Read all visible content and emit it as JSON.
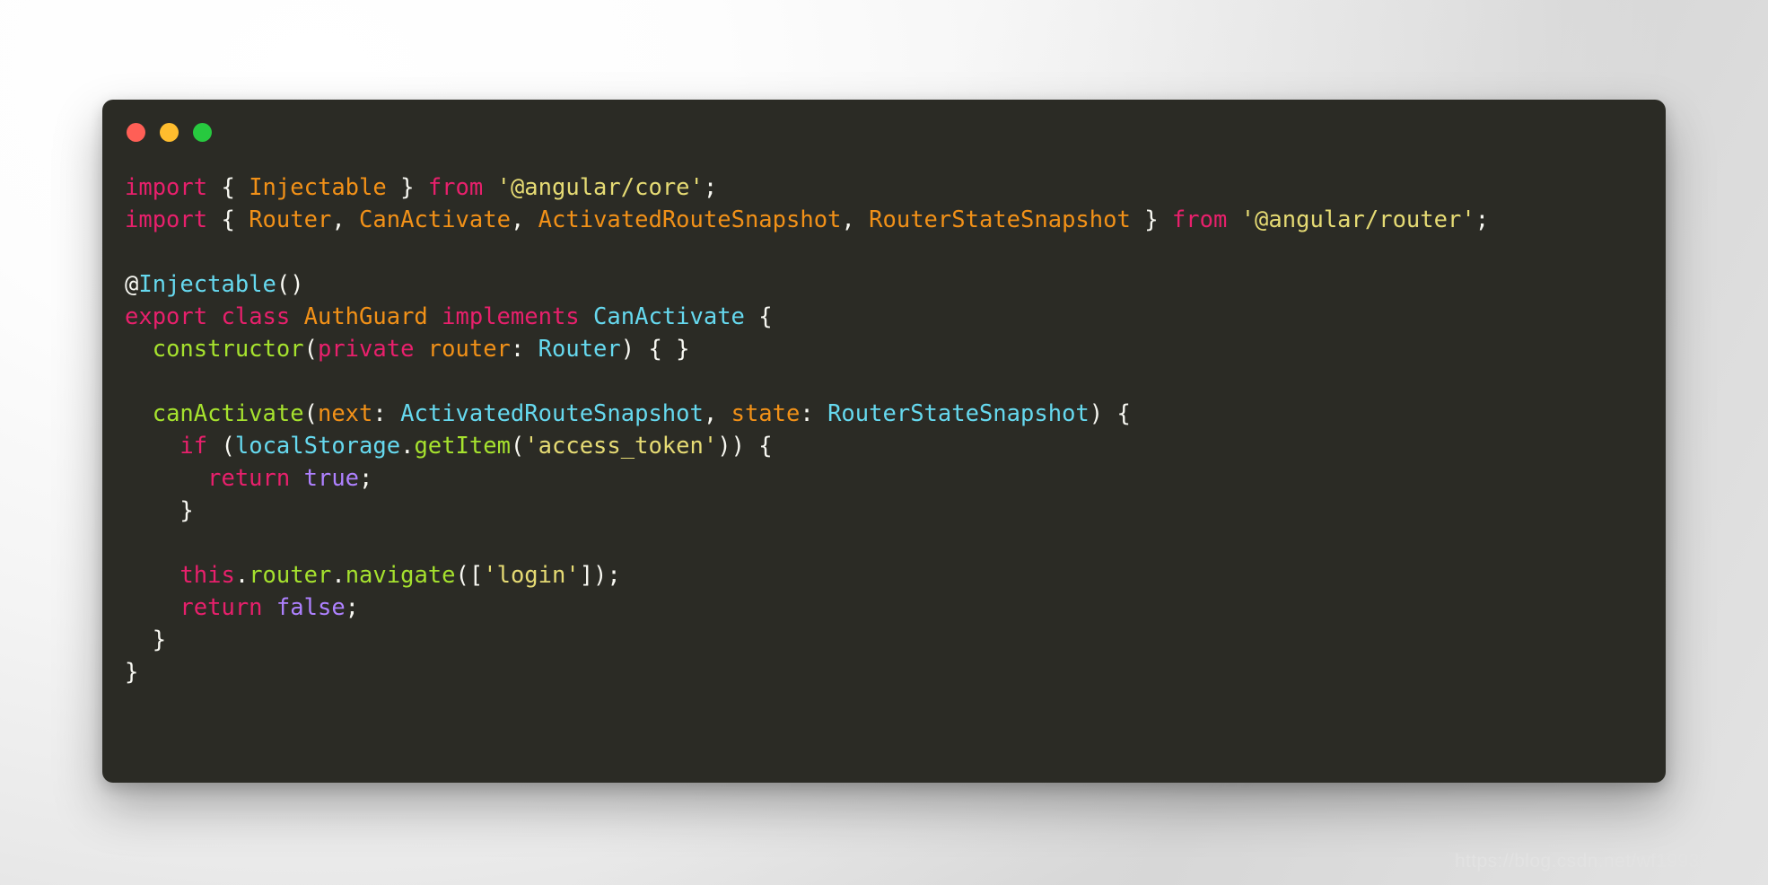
{
  "window": {
    "traffic_lights": [
      {
        "name": "close",
        "color": "#ff5f56"
      },
      {
        "name": "minimize",
        "color": "#ffbd2e"
      },
      {
        "name": "maximize",
        "color": "#27c93f"
      }
    ]
  },
  "theme": {
    "panel_background": "#2b2b25",
    "page_background": "#f2f2f2",
    "keyword": "#e8206c",
    "identifier": "#f29118",
    "string": "#e6db74",
    "type": "#66d9ef",
    "function": "#a6e22e",
    "boolean": "#ae81ff",
    "punctuation": "#f8f8f2"
  },
  "code": {
    "language": "typescript",
    "plain_text": "import { Injectable } from '@angular/core';\nimport { Router, CanActivate, ActivatedRouteSnapshot, RouterStateSnapshot } from '@angular/router';\n\n@Injectable()\nexport class AuthGuard implements CanActivate {\n  constructor(private router: Router) { }\n\n  canActivate(next: ActivatedRouteSnapshot, state: RouterStateSnapshot) {\n    if (localStorage.getItem('access_token')) {\n      return true;\n    }\n\n    this.router.navigate(['login']);\n    return false;\n  }\n}",
    "lines": [
      {
        "n": 1,
        "tokens": [
          {
            "t": "import",
            "c": "kw"
          },
          {
            "t": " ",
            "c": "punc"
          },
          {
            "t": "{",
            "c": "punc"
          },
          {
            "t": " ",
            "c": "punc"
          },
          {
            "t": "Injectable",
            "c": "ident"
          },
          {
            "t": " ",
            "c": "punc"
          },
          {
            "t": "}",
            "c": "punc"
          },
          {
            "t": " ",
            "c": "punc"
          },
          {
            "t": "from",
            "c": "kw"
          },
          {
            "t": " ",
            "c": "punc"
          },
          {
            "t": "'@angular/core'",
            "c": "str"
          },
          {
            "t": ";",
            "c": "punc"
          }
        ]
      },
      {
        "n": 2,
        "tokens": [
          {
            "t": "import",
            "c": "kw"
          },
          {
            "t": " ",
            "c": "punc"
          },
          {
            "t": "{",
            "c": "punc"
          },
          {
            "t": " ",
            "c": "punc"
          },
          {
            "t": "Router",
            "c": "ident"
          },
          {
            "t": ", ",
            "c": "punc"
          },
          {
            "t": "CanActivate",
            "c": "ident"
          },
          {
            "t": ", ",
            "c": "punc"
          },
          {
            "t": "ActivatedRouteSnapshot",
            "c": "ident"
          },
          {
            "t": ", ",
            "c": "punc"
          },
          {
            "t": "RouterStateSnapshot",
            "c": "ident"
          },
          {
            "t": " ",
            "c": "punc"
          },
          {
            "t": "}",
            "c": "punc"
          },
          {
            "t": " ",
            "c": "punc"
          },
          {
            "t": "from",
            "c": "kw"
          },
          {
            "t": " ",
            "c": "punc"
          },
          {
            "t": "'@angular/router'",
            "c": "str"
          },
          {
            "t": ";",
            "c": "punc"
          }
        ]
      },
      {
        "n": 3,
        "tokens": []
      },
      {
        "n": 4,
        "tokens": [
          {
            "t": "@",
            "c": "punc"
          },
          {
            "t": "Injectable",
            "c": "type"
          },
          {
            "t": "()",
            "c": "punc"
          }
        ]
      },
      {
        "n": 5,
        "tokens": [
          {
            "t": "export",
            "c": "kw"
          },
          {
            "t": " ",
            "c": "punc"
          },
          {
            "t": "class",
            "c": "kw"
          },
          {
            "t": " ",
            "c": "punc"
          },
          {
            "t": "AuthGuard",
            "c": "ident"
          },
          {
            "t": " ",
            "c": "punc"
          },
          {
            "t": "implements",
            "c": "kw"
          },
          {
            "t": " ",
            "c": "punc"
          },
          {
            "t": "CanActivate",
            "c": "type"
          },
          {
            "t": " ",
            "c": "punc"
          },
          {
            "t": "{",
            "c": "punc"
          }
        ]
      },
      {
        "n": 6,
        "tokens": [
          {
            "t": "  ",
            "c": "punc"
          },
          {
            "t": "constructor",
            "c": "fn"
          },
          {
            "t": "(",
            "c": "punc"
          },
          {
            "t": "private",
            "c": "kw"
          },
          {
            "t": " ",
            "c": "punc"
          },
          {
            "t": "router",
            "c": "ident"
          },
          {
            "t": ": ",
            "c": "punc"
          },
          {
            "t": "Router",
            "c": "type"
          },
          {
            "t": ") { }",
            "c": "punc"
          }
        ]
      },
      {
        "n": 7,
        "tokens": []
      },
      {
        "n": 8,
        "tokens": [
          {
            "t": "  ",
            "c": "punc"
          },
          {
            "t": "canActivate",
            "c": "fn"
          },
          {
            "t": "(",
            "c": "punc"
          },
          {
            "t": "next",
            "c": "ident"
          },
          {
            "t": ": ",
            "c": "punc"
          },
          {
            "t": "ActivatedRouteSnapshot",
            "c": "type"
          },
          {
            "t": ", ",
            "c": "punc"
          },
          {
            "t": "state",
            "c": "ident"
          },
          {
            "t": ": ",
            "c": "punc"
          },
          {
            "t": "RouterStateSnapshot",
            "c": "type"
          },
          {
            "t": ") {",
            "c": "punc"
          }
        ]
      },
      {
        "n": 9,
        "tokens": [
          {
            "t": "    ",
            "c": "punc"
          },
          {
            "t": "if",
            "c": "kw"
          },
          {
            "t": " (",
            "c": "punc"
          },
          {
            "t": "localStorage",
            "c": "type"
          },
          {
            "t": ".",
            "c": "punc"
          },
          {
            "t": "getItem",
            "c": "fn"
          },
          {
            "t": "(",
            "c": "punc"
          },
          {
            "t": "'access_token'",
            "c": "str"
          },
          {
            "t": ")) {",
            "c": "punc"
          }
        ]
      },
      {
        "n": 10,
        "tokens": [
          {
            "t": "      ",
            "c": "punc"
          },
          {
            "t": "return",
            "c": "kw"
          },
          {
            "t": " ",
            "c": "punc"
          },
          {
            "t": "true",
            "c": "bool"
          },
          {
            "t": ";",
            "c": "punc"
          }
        ]
      },
      {
        "n": 11,
        "tokens": [
          {
            "t": "    }",
            "c": "punc"
          }
        ]
      },
      {
        "n": 12,
        "tokens": []
      },
      {
        "n": 13,
        "tokens": [
          {
            "t": "    ",
            "c": "punc"
          },
          {
            "t": "this",
            "c": "kw"
          },
          {
            "t": ".",
            "c": "punc"
          },
          {
            "t": "router",
            "c": "fn"
          },
          {
            "t": ".",
            "c": "punc"
          },
          {
            "t": "navigate",
            "c": "fn"
          },
          {
            "t": "([",
            "c": "punc"
          },
          {
            "t": "'login'",
            "c": "str"
          },
          {
            "t": "]);",
            "c": "punc"
          }
        ]
      },
      {
        "n": 14,
        "tokens": [
          {
            "t": "    ",
            "c": "punc"
          },
          {
            "t": "return",
            "c": "kw"
          },
          {
            "t": " ",
            "c": "punc"
          },
          {
            "t": "false",
            "c": "bool"
          },
          {
            "t": ";",
            "c": "punc"
          }
        ]
      },
      {
        "n": 15,
        "tokens": [
          {
            "t": "  }",
            "c": "punc"
          }
        ]
      },
      {
        "n": 16,
        "tokens": [
          {
            "t": "}",
            "c": "punc"
          }
        ]
      }
    ]
  },
  "watermark": {
    "text": "https://blog.csdn.net/wf19930209"
  }
}
